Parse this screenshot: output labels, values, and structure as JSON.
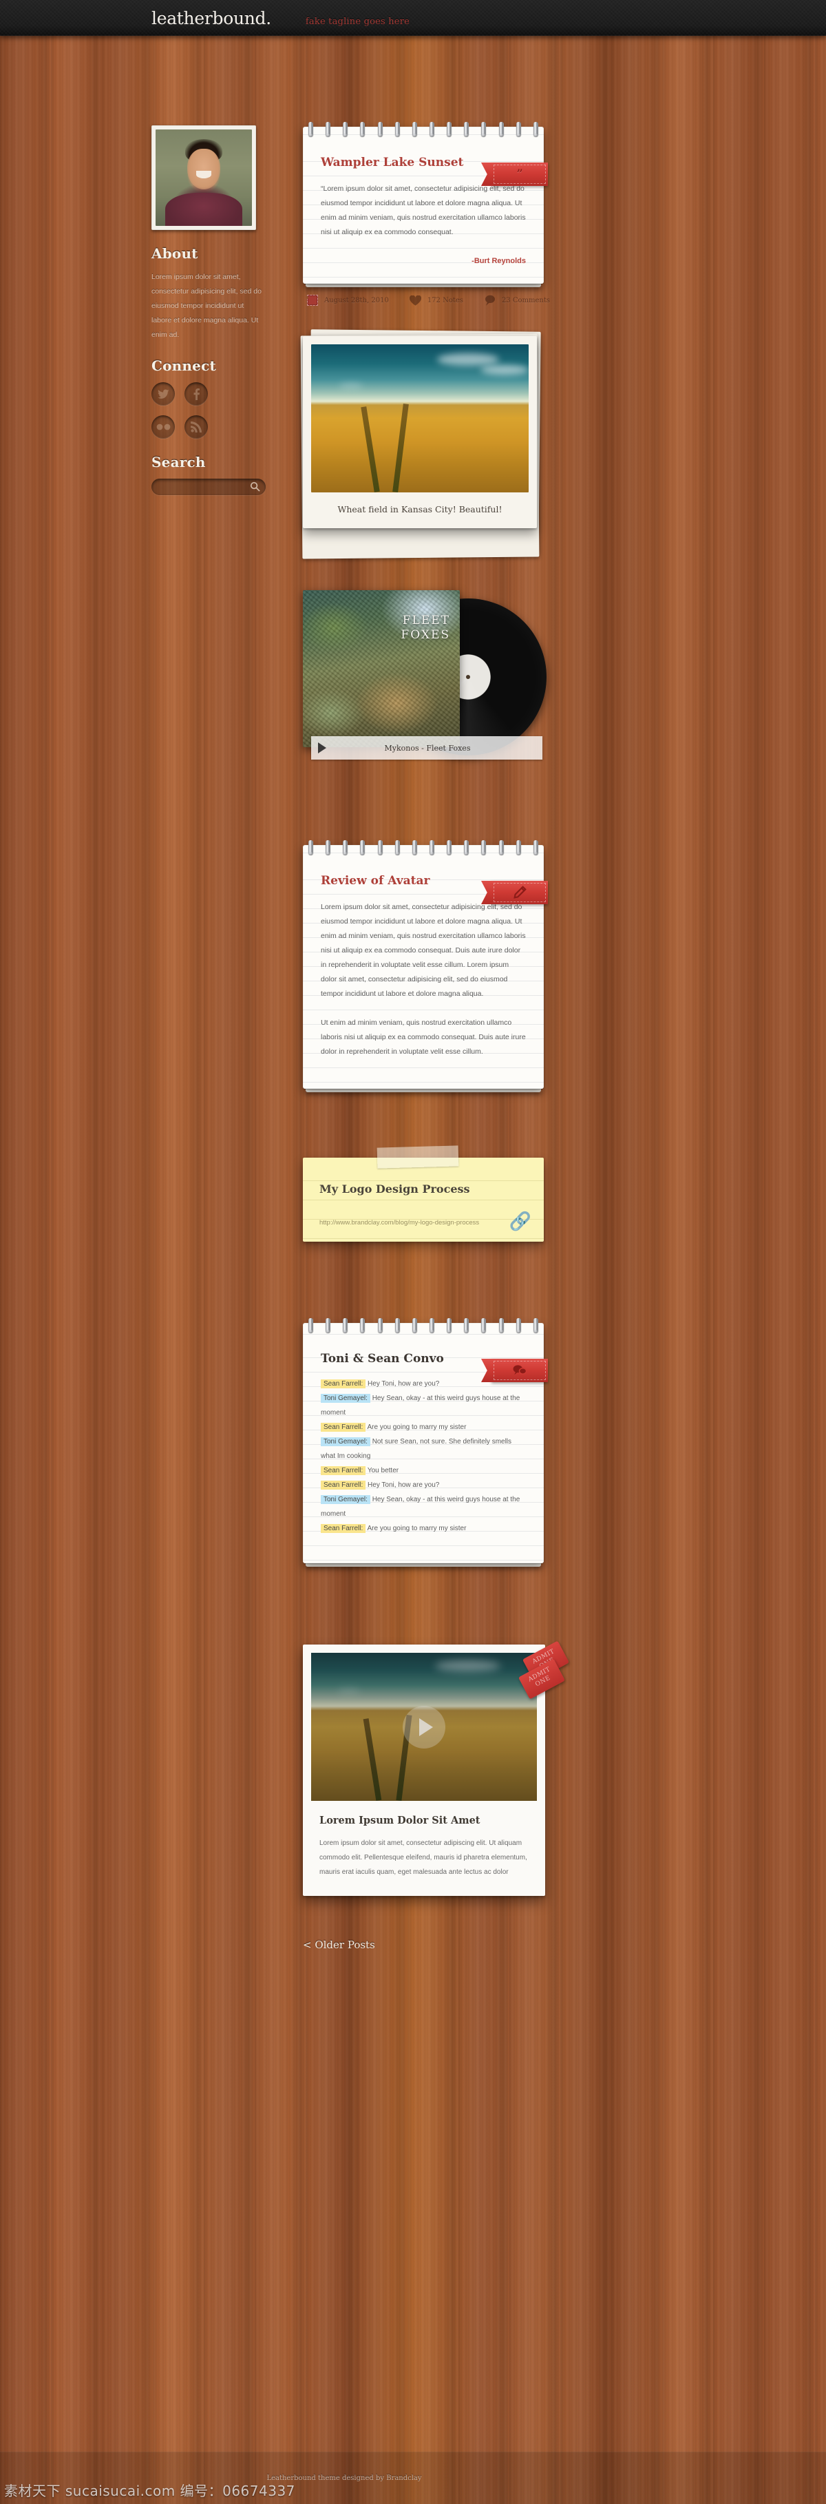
{
  "header": {
    "logo": "leatherbound.",
    "tagline": "fake tagline goes here"
  },
  "sidebar": {
    "avatar_alt": "profile-photo",
    "about_heading": "About",
    "about_text": "Lorem ipsum dolor sit amet, consectetur adipisicing elit, sed do eiusmod tempor incididunt ut labore et dolore magna aliqua. Ut enim ad.",
    "connect_heading": "Connect",
    "social": [
      {
        "name": "twitter",
        "glyph": "t"
      },
      {
        "name": "facebook",
        "glyph": "f"
      },
      {
        "name": "flickr",
        "glyph": "●●"
      },
      {
        "name": "rss",
        "glyph": "\u0001"
      }
    ],
    "search_heading": "Search",
    "search_value": "",
    "search_placeholder": ""
  },
  "posts": {
    "quote": {
      "title": "Wampler Lake Sunset",
      "ribbon_icon": "quote-icon",
      "ribbon_glyph": "”",
      "body": "“Lorem ipsum dolor sit amet, consectetur adipisicing elit, sed do eiusmod tempor incididunt ut labore et dolore magna aliqua. Ut enim ad minim veniam, quis nostrud exercitation ullamco laboris nisi ut aliquip ex ea commodo consequat.",
      "author": "-Burt Reynolds",
      "meta": {
        "date": "August 28th, 2010",
        "notes": "172 Notes",
        "comments": "23 Comments"
      }
    },
    "photo": {
      "caption": "Wheat field in Kansas City! Beautiful!"
    },
    "audio": {
      "album_band": "FLEET\nFOXES",
      "band_line1": "FLEET",
      "band_line2": "FOXES",
      "track": "Mykonos - Fleet Foxes",
      "play_label": "play-button"
    },
    "text": {
      "title": "Review of Avatar",
      "ribbon_icon": "pencil-icon",
      "paragraph1": "Lorem ipsum dolor sit amet, consectetur adipisicing elit, sed do eiusmod tempor incididunt ut labore et dolore magna aliqua. Ut enim ad minim veniam, quis nostrud exercitation ullamco laboris nisi ut aliquip ex ea commodo consequat. Duis aute irure dolor in reprehenderit in voluptate velit esse cillum.  Lorem ipsum dolor sit amet, consectetur adipisicing elit, sed do eiusmod tempor incididunt ut labore et dolore magna aliqua.",
      "paragraph2": "Ut enim ad minim veniam, quis nostrud exercitation ullamco laboris nisi ut aliquip ex ea commodo consequat. Duis aute irure dolor in reprehenderit in voluptate velit esse cillum."
    },
    "link": {
      "title": "My Logo Design Process",
      "url": "http://www.brandclay.com/blog/my-logo-design-process",
      "chain_icon": "link-chain-icon"
    },
    "chat": {
      "title": "Toni & Sean Convo",
      "ribbon_icon": "chat-bubbles-icon",
      "lines": [
        {
          "speaker": "Sean Farrell:",
          "side": "a",
          "text": "Hey Toni, how are you?"
        },
        {
          "speaker": "Toni Gemayel:",
          "side": "b",
          "text": "Hey Sean, okay - at this weird guys house at the moment"
        },
        {
          "speaker": "Sean Farrell:",
          "side": "a",
          "text": "Are you going to marry my sister"
        },
        {
          "speaker": "Toni Gemayel:",
          "side": "b",
          "text": "Not sure Sean, not sure.  She definitely smells what Im cooking"
        },
        {
          "speaker": "Sean Farrell:",
          "side": "a",
          "text": "You better"
        },
        {
          "speaker": "Sean Farrell:",
          "side": "a",
          "text": "Hey Toni, how are you?"
        },
        {
          "speaker": "Toni Gemayel:",
          "side": "b",
          "text": "Hey Sean, okay - at this weird guys house at the moment"
        },
        {
          "speaker": "Sean Farrell:",
          "side": "a",
          "text": "Are you going to marry my sister"
        }
      ]
    },
    "video": {
      "title": "Lorem Ipsum Dolor Sit Amet",
      "text": "Lorem ipsum dolor sit amet, consectetur adipiscing elit. Ut aliquam commodo elit. Pellentesque eleifend, mauris id pharetra elementum, mauris erat iaculis quam, eget malesuada ante lectus ac dolor",
      "ticket1_line1": "ADMIT",
      "ticket1_line2": "ONE",
      "ticket2_line1": "ADMIT",
      "ticket2_line2": "ONE",
      "play_label": "play-button"
    }
  },
  "pagination": {
    "older": "< Older Posts"
  },
  "footer": {
    "credit": "Leatherbound theme designed by Brandclay",
    "watermark": "素材天下 sucaisucai.com 编号：06674337"
  },
  "colors": {
    "accent_red": "#ae4039",
    "ribbon_red": "#cf3a34",
    "wood": "#9d5630",
    "header_dark": "#1a1a1a",
    "chat_yellow": "#fae58c",
    "chat_blue": "#b9e3f6",
    "sticky_yellow": "#fbf5b8"
  }
}
